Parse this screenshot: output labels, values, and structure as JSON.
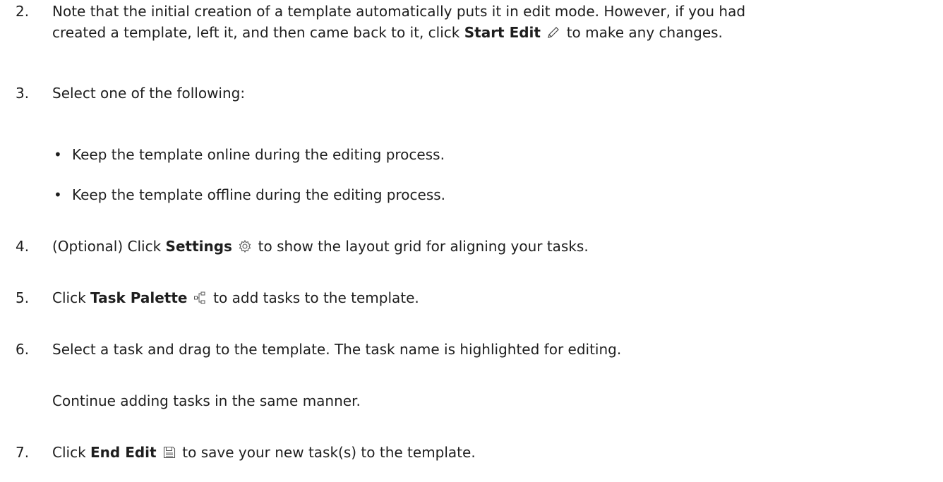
{
  "steps": [
    {
      "number": "2.",
      "line1": "Note that the initial creation of a template automatically puts it in edit mode. However, if you had",
      "line2_pre": "created a template, left it, and then came back to it, click ",
      "line2_bold": "Start Edit",
      "line2_icon": "pencil-icon",
      "line2_post": " to make any changes."
    },
    {
      "number": "3.",
      "text": "Select one of the following:",
      "bullets": [
        "Keep the template online during the editing process.",
        "Keep the template offline during the editing process."
      ]
    },
    {
      "number": "4.",
      "pre": "(Optional) Click ",
      "bold": "Settings",
      "icon": "gear-icon",
      "post": " to show the layout grid for aligning your tasks."
    },
    {
      "number": "5.",
      "pre": "Click ",
      "bold": "Task Palette",
      "icon": "task-palette-icon",
      "post": " to add tasks to the template."
    },
    {
      "number": "6.",
      "text": "Select a task and drag to the template. The task name is highlighted for editing.",
      "followup": "Continue adding tasks in the same manner."
    },
    {
      "number": "7.",
      "pre": "Click ",
      "bold": "End Edit",
      "icon": "save-icon",
      "post": " to save your new task(s) to the template."
    }
  ],
  "bullet_glyph": "•"
}
